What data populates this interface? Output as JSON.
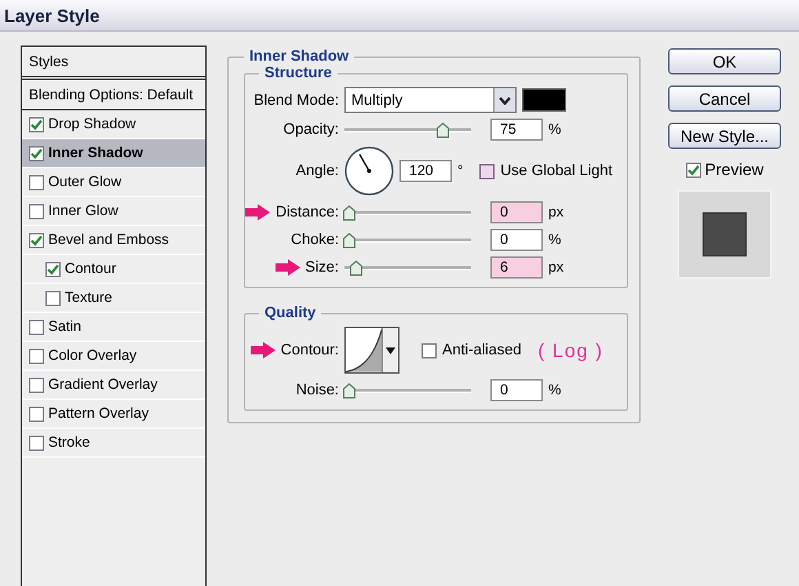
{
  "window": {
    "title": "Layer Style"
  },
  "styles_panel": {
    "items": [
      {
        "label": "Styles",
        "kind": "header",
        "selected": false
      },
      {
        "label": "Blending Options: Default",
        "kind": "header",
        "selected": false
      },
      {
        "label": "Drop Shadow",
        "kind": "effect",
        "checked": true,
        "selected": false
      },
      {
        "label": "Inner Shadow",
        "kind": "effect",
        "checked": true,
        "selected": true
      },
      {
        "label": "Outer Glow",
        "kind": "effect",
        "checked": false,
        "selected": false
      },
      {
        "label": "Inner Glow",
        "kind": "effect",
        "checked": false,
        "selected": false
      },
      {
        "label": "Bevel and Emboss",
        "kind": "effect",
        "checked": true,
        "selected": false,
        "children": [
          {
            "label": "Contour",
            "kind": "effect",
            "checked": true,
            "selected": false
          },
          {
            "label": "Texture",
            "kind": "effect",
            "checked": false,
            "selected": false
          }
        ]
      },
      {
        "label": "Satin",
        "kind": "effect",
        "checked": false,
        "selected": false
      },
      {
        "label": "Color Overlay",
        "kind": "effect",
        "checked": false,
        "selected": false
      },
      {
        "label": "Gradient Overlay",
        "kind": "effect",
        "checked": false,
        "selected": false
      },
      {
        "label": "Pattern Overlay",
        "kind": "effect",
        "checked": false,
        "selected": false
      },
      {
        "label": "Stroke",
        "kind": "effect",
        "checked": false,
        "selected": false
      }
    ]
  },
  "panel": {
    "title": "Inner Shadow",
    "structure": {
      "title": "Structure",
      "blend_mode": {
        "label": "Blend Mode:",
        "value": "Multiply"
      },
      "opacity": {
        "label": "Opacity:",
        "level": 0.75,
        "value": "75",
        "unit": "%",
        "annotated": false,
        "highlighted": false
      },
      "angle": {
        "label": "Angle:",
        "value": "120",
        "unit": "°"
      },
      "use_global_light": {
        "label": "Use Global Light",
        "checked": false
      },
      "sliders": [
        {
          "label": "Distance:",
          "level": 0,
          "value": "0",
          "unit": "px",
          "annotated": true,
          "highlighted": true
        },
        {
          "label": "Choke:",
          "level": 0,
          "value": "0",
          "unit": "%",
          "annotated": false,
          "highlighted": false
        },
        {
          "label": "Size:",
          "level": 0.06,
          "value": "6",
          "unit": "px",
          "annotated": true,
          "highlighted": true
        }
      ]
    },
    "quality": {
      "title": "Quality",
      "contour": {
        "label": "Contour:",
        "annotated": true
      },
      "anti_aliased": {
        "label": "Anti-aliased",
        "checked": false
      },
      "note": "( Log )",
      "noise": {
        "label": "Noise:",
        "level": 0,
        "value": "0",
        "unit": "%",
        "annotated": false,
        "highlighted": false
      }
    }
  },
  "buttons": [
    "OK",
    "Cancel",
    "New Style..."
  ],
  "preview": {
    "label": "Preview",
    "checked": true
  }
}
